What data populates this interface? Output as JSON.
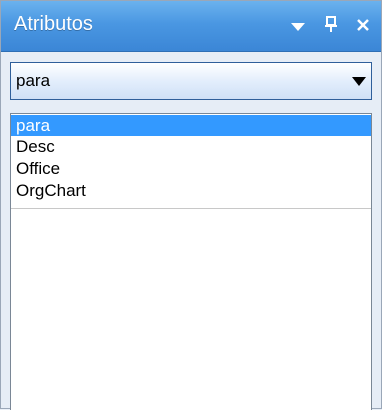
{
  "panel": {
    "title": "Atributos",
    "icons": [
      "dropdown-arrow-icon",
      "pin-icon",
      "close-icon"
    ]
  },
  "dropdown": {
    "value": "para"
  },
  "list": {
    "items": [
      {
        "label": "para",
        "selected": true
      },
      {
        "label": "Desc",
        "selected": false
      },
      {
        "label": "Office",
        "selected": false
      },
      {
        "label": "OrgChart",
        "selected": false
      }
    ]
  },
  "colors": {
    "titlebar": "#4a97e2",
    "selection": "#3399ff"
  }
}
